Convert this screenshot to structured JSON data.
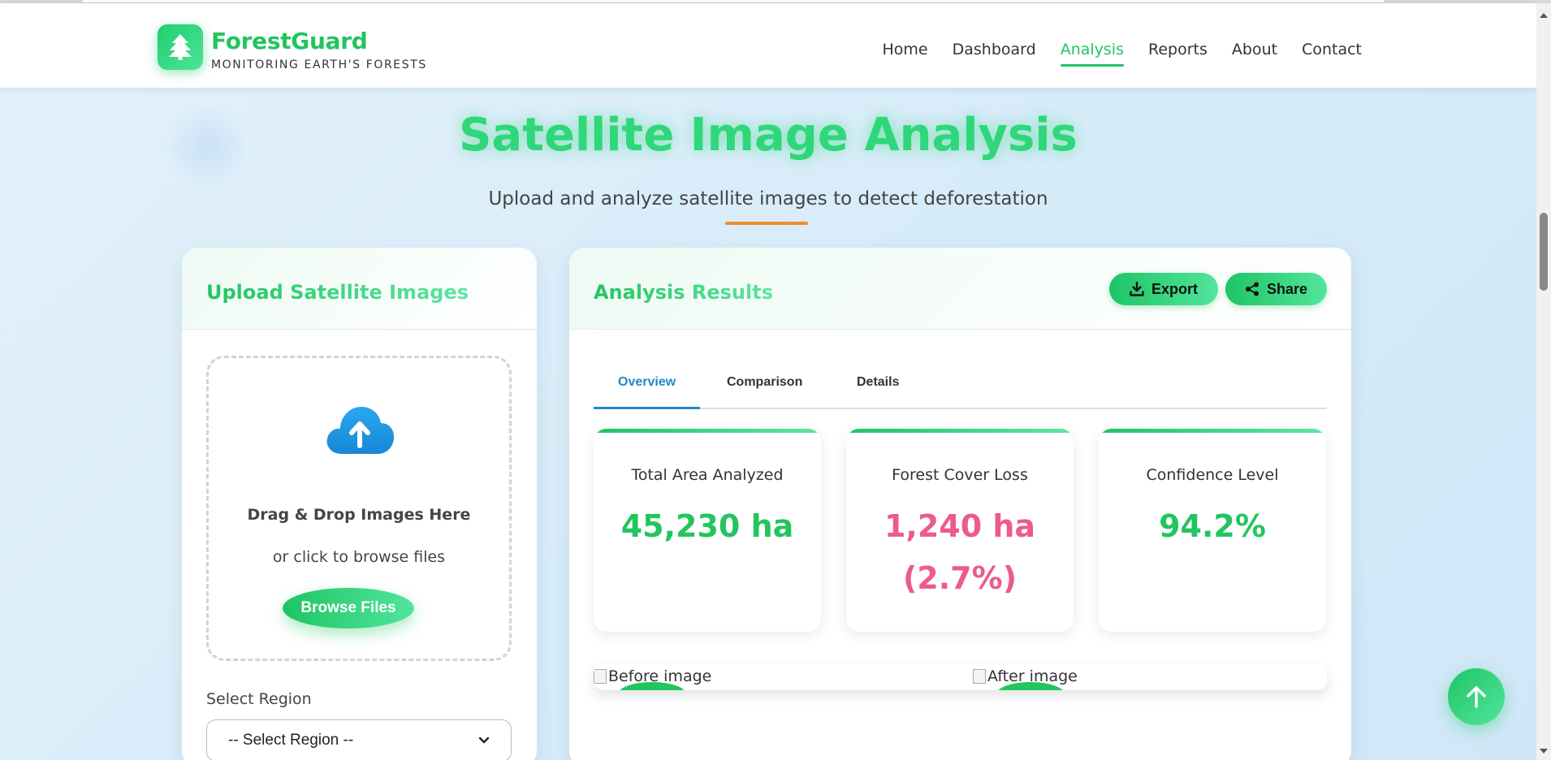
{
  "brand": {
    "name": "ForestGuard",
    "tagline": "MONITORING EARTH'S FORESTS"
  },
  "nav": {
    "items": [
      {
        "label": "Home",
        "active": false
      },
      {
        "label": "Dashboard",
        "active": false
      },
      {
        "label": "Analysis",
        "active": true
      },
      {
        "label": "Reports",
        "active": false
      },
      {
        "label": "About",
        "active": false
      },
      {
        "label": "Contact",
        "active": false
      }
    ]
  },
  "hero": {
    "title": "Satellite Image Analysis",
    "subtitle": "Upload and analyze satellite images to detect deforestation"
  },
  "upload": {
    "title": "Upload Satellite Images",
    "drop_title": "Drag & Drop Images Here",
    "drop_sub": "or click to browse files",
    "browse_label": "Browse Files",
    "region_label": "Select Region",
    "region_selected": "-- Select Region --"
  },
  "results": {
    "title": "Analysis Results",
    "export_label": "Export",
    "share_label": "Share",
    "tabs": [
      {
        "label": "Overview",
        "active": true
      },
      {
        "label": "Comparison",
        "active": false
      },
      {
        "label": "Details",
        "active": false
      }
    ],
    "stats": [
      {
        "label": "Total Area Analyzed",
        "value": "45,230 ha"
      },
      {
        "label": "Forest Cover Loss",
        "value": "1,240 ha (2.7%)"
      },
      {
        "label": "Confidence Level",
        "value": "94.2%"
      }
    ],
    "before_alt": "Before image",
    "after_alt": "After image"
  },
  "colors": {
    "accent": "#22c55e",
    "loss": "#ec5b8c",
    "tab_active": "#1e88c8",
    "underline": "#f28b30"
  },
  "icons": {
    "logo": "tree-icon",
    "upload": "cloud-upload-icon",
    "export": "download-icon",
    "share": "share-icon",
    "fab": "arrow-up-icon"
  }
}
